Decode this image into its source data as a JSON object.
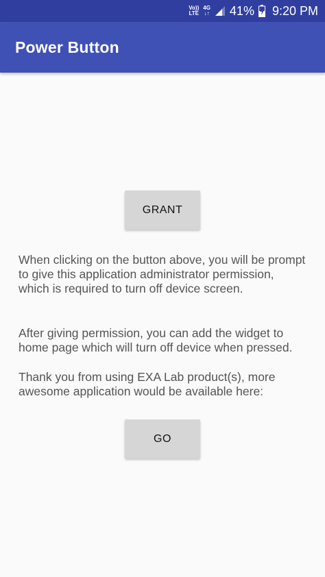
{
  "status_bar": {
    "volte_line1": "Vo))",
    "volte_line2": "LTE",
    "network": "4G",
    "network_arrows": "↓↑",
    "battery_percent": "41%",
    "time": "9:20 PM"
  },
  "app_bar": {
    "title": "Power Button"
  },
  "content": {
    "grant_label": "GRANT",
    "paragraph_1": "When clicking on the button above, you will be prompt to give this application administrator permission, which is required to turn off device screen.",
    "paragraph_2": "After giving permission, you can add the widget to home page which will turn off device when pressed.",
    "paragraph_3": "Thank you from using EXA Lab product(s), more awesome application would be available here:",
    "go_label": "GO"
  },
  "colors": {
    "status_bar": "#303f9f",
    "app_bar": "#3f51b5",
    "background": "#fafafa",
    "button": "#d6d6d6",
    "text": "#555555"
  },
  "icons": [
    "signal-icon",
    "battery-charging-icon"
  ]
}
